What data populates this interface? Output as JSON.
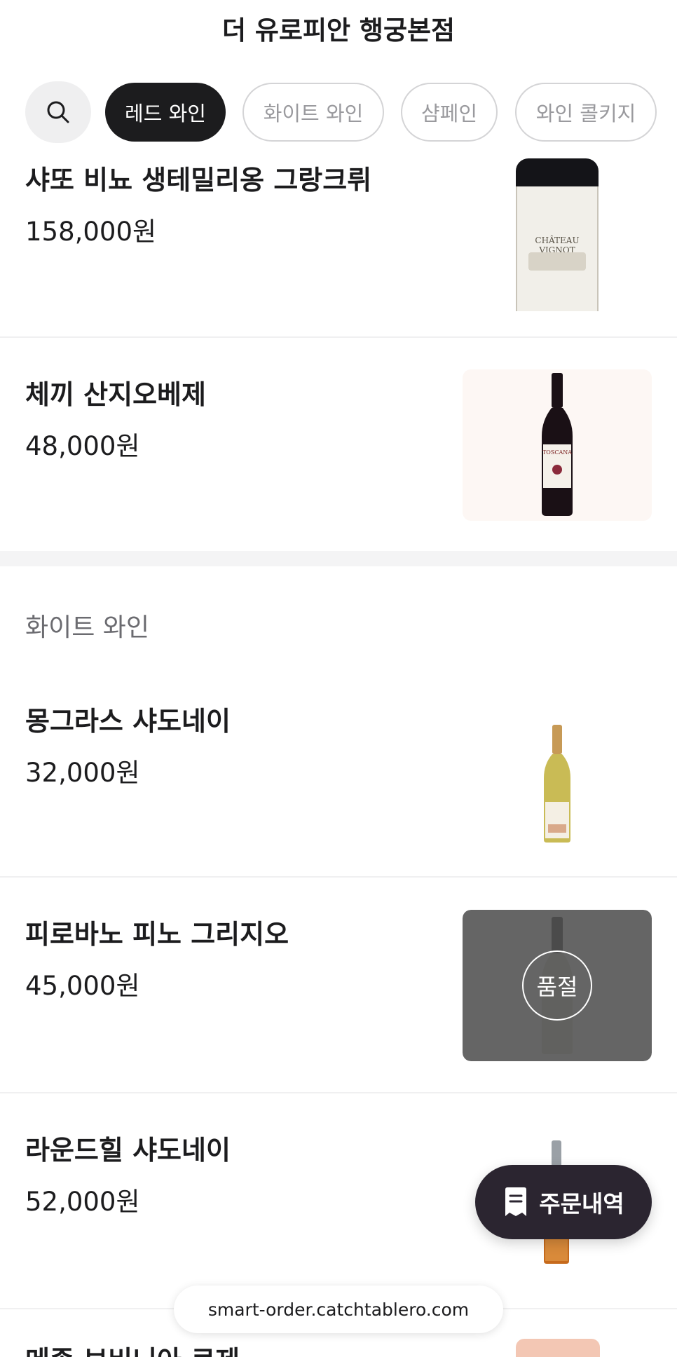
{
  "header": {
    "title": "더 유로피안 행궁본점"
  },
  "filters": {
    "search_icon": "search-icon",
    "chips": [
      {
        "label": "레드 와인",
        "active": true
      },
      {
        "label": "화이트 와인",
        "active": false
      },
      {
        "label": "샴페인",
        "active": false
      },
      {
        "label": "와인 콜키지",
        "active": false
      }
    ]
  },
  "red_items": [
    {
      "name": "샤또 비뇨 생테밀리옹 그랑크뤼",
      "price": "158,000원",
      "thumb_label": "CHÂTEAU VIGNOT"
    },
    {
      "name": "체끼 산지오베제",
      "price": "48,000원",
      "thumb_label": "TOSCANA"
    }
  ],
  "white_section": {
    "title": "화이트 와인",
    "items": [
      {
        "name": "몽그라스 샤도네이",
        "price": "32,000원",
        "sold_out": false
      },
      {
        "name": "피로바노 피노 그리지오",
        "price": "45,000원",
        "sold_out": true,
        "sold_out_label": "품절"
      },
      {
        "name": "라운드힐 샤도네이",
        "price": "52,000원",
        "sold_out": false
      }
    ]
  },
  "partial_item": {
    "name": "메종 보비니아 로제"
  },
  "order_button": {
    "label": "주문내역",
    "icon": "receipt-icon"
  },
  "url_bar": {
    "text": "smart-order.catchtablero.com"
  },
  "colors": {
    "dark": "#1c1c1e",
    "order_button_bg": "#2b2530",
    "chip_border": "#d4d4d6"
  }
}
